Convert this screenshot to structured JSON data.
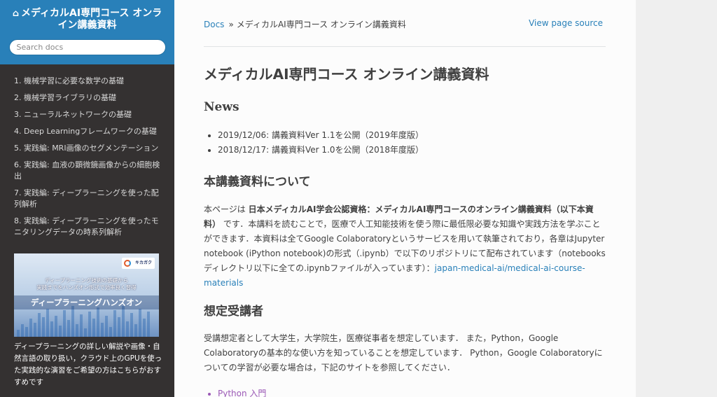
{
  "sidebar": {
    "title": "メディカルAI専門コース オンライン講義資料",
    "home_icon": "home-icon",
    "search_placeholder": "Search docs",
    "items": [
      {
        "label": "1. 機械学習に必要な数学の基礎"
      },
      {
        "label": "2. 機械学習ライブラリの基礎"
      },
      {
        "label": "3. ニューラルネットワークの基礎"
      },
      {
        "label": "4. Deep Learningフレームワークの基礎"
      },
      {
        "label": "5. 実践編: MRI画像のセグメンテーション"
      },
      {
        "label": "6. 実践編: 血液の顕微鏡画像からの細胞検出"
      },
      {
        "label": "7. 実践編: ディープラーニングを使った配列解析"
      },
      {
        "label": "8. 実践編: ディープラーニングを使ったモニタリングデータの時系列解析"
      }
    ],
    "banner": {
      "logo_text": "キカガク",
      "subtitle_line1": "ディープラーニング技術の基礎から",
      "subtitle_line2": "実践までをハンズオン形式で効率良く習得",
      "main": "ディープラーニングハンズオン"
    },
    "description": "ディープラーニングの詳しい解説や画像・自然言語の取り扱い，クラウド上のGPUを使った実践的な演習をご希望の方はこちらがおすすめです"
  },
  "breadcrumb": {
    "docs": "Docs",
    "separator": "»",
    "current": "メディカルAI専門コース オンライン講義資料",
    "view_source": "View page source"
  },
  "main": {
    "title": "メディカルAI専門コース オンライン講義資料",
    "news_heading": "News",
    "news": [
      "2019/12/06: 講義資料Ver 1.1を公開（2019年度版）",
      "2018/12/17: 講義資料Ver 1.0を公開（2018年度版）"
    ],
    "about_heading": "本講義資料について",
    "about_pre": "本ページは ",
    "about_bold": "日本メディカルAI学会公認資格：メディカルAI専門コースのオンライン講義資料（以下本資料）",
    "about_post": " です．本講料を読むことで，医療で人工知能技術を使う際に最低限必要な知識や実践方法を学ぶことができます．本資料は全てGoogle Colaboratoryというサービスを用いて執筆されており，各章はJupyter notebook (iPython notebook)の形式（.ipynb）で以下のリポジトリにて配布されています（notebooksディレクトリ以下に全ての.ipynbファイルが入っています）：",
    "about_link": "japan-medical-ai/medical-ai-course-materials",
    "audience_heading": "想定受講者",
    "audience_text": "受講想定者として大学生，大学院生，医療従事者を想定しています． また，Python，Google Colaboratoryの基本的な使い方を知っていることを想定しています． Python，Google Colaboratoryについての学習が必要な場合は，下記のサイトを参照してください．",
    "links": [
      "Python 入門"
    ]
  },
  "colors": {
    "sidebar_bg": "#343131",
    "sidebar_header": "#2980b9",
    "link": "#2980b9",
    "visited_link": "#9b59b6",
    "text": "#404040"
  }
}
